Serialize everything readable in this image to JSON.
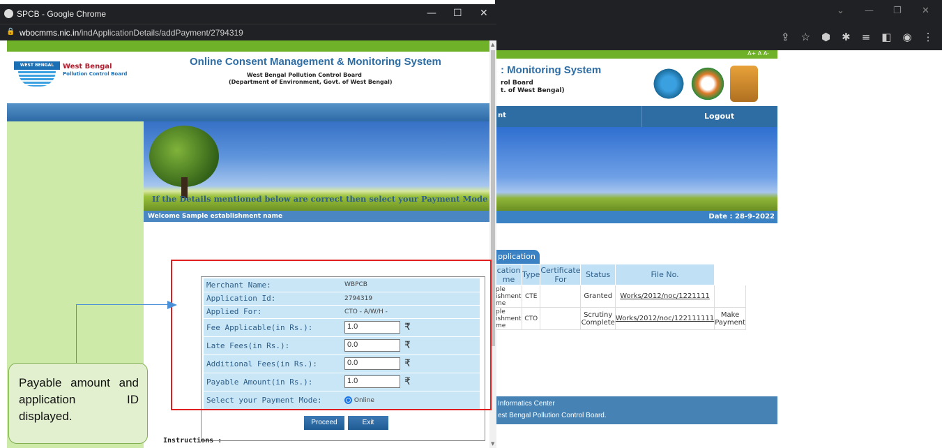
{
  "popup_window": {
    "title": "SPCB - Google Chrome",
    "url_domain": "wbocmms.nic.in",
    "url_path": "/indApplicationDetails/addPayment/2794319",
    "minimize": "—",
    "maximize": "☐",
    "close": "✕"
  },
  "header": {
    "org_name": "West Bengal",
    "org_sub": "Pollution Control Board",
    "logo_text": "WEST BENGAL",
    "title": "Online Consent Management & Monitoring System",
    "sub1": "West Bengal Pollution Control Board",
    "sub2": "(Department of Environment, Govt. of West Bengal)"
  },
  "welcome": "Welcome Sample establishment name",
  "instruction_line": "If the Details mentioned below are correct then select your Payment Mode to st",
  "payment": {
    "merchant_label": "Merchant Name:",
    "merchant_value": "WBPCB",
    "appid_label": "Application Id:",
    "appid_value": "2794319",
    "applied_label": "Applied For:",
    "applied_value": "CTO - A/W/H -",
    "fee_label": "Fee Applicable(in Rs.):",
    "fee_value": "1.0",
    "late_label": "Late Fees(in Rs.):",
    "late_value": "0.0",
    "addl_label": "Additional Fees(in Rs.):",
    "addl_value": "0.0",
    "payable_label": "Payable Amount(in Rs.):",
    "payable_value": "1.0",
    "mode_label": "Select your Payment Mode:",
    "mode_value": "Online",
    "rupee": "₹",
    "proceed": "Proceed",
    "exit": "Exit"
  },
  "instructions_label": "Instructions :",
  "callout": "Payable amount and application ID displayed.",
  "background_page": {
    "accessibility": "A+ A A-",
    "title_fragment": ": Monitoring System",
    "sub1_fragment": "rol Board",
    "sub2_fragment": "t. of West Bengal)",
    "nav_fragment": "nt",
    "logout": "Logout",
    "date": "Date : 28-9-2022",
    "tab": "pplication",
    "table_headers": [
      "cation\nme",
      "Type",
      "Certificate\nFor",
      "Status",
      "File No.",
      ""
    ],
    "rows": [
      {
        "name": "ple\nishment\nme",
        "type": "CTE",
        "cert": "",
        "status": "Granted",
        "file": "Works/2012/noc/1221111",
        "action": ""
      },
      {
        "name": "ple\nishment\nme",
        "type": "CTO",
        "cert": "",
        "status": "Scrutiny\nComplete",
        "file": "Works/2012/noc/122111111",
        "action": "Make\nPayment"
      }
    ],
    "footer1": "Informatics Center",
    "footer2": "est Bengal Pollution Control Board."
  }
}
